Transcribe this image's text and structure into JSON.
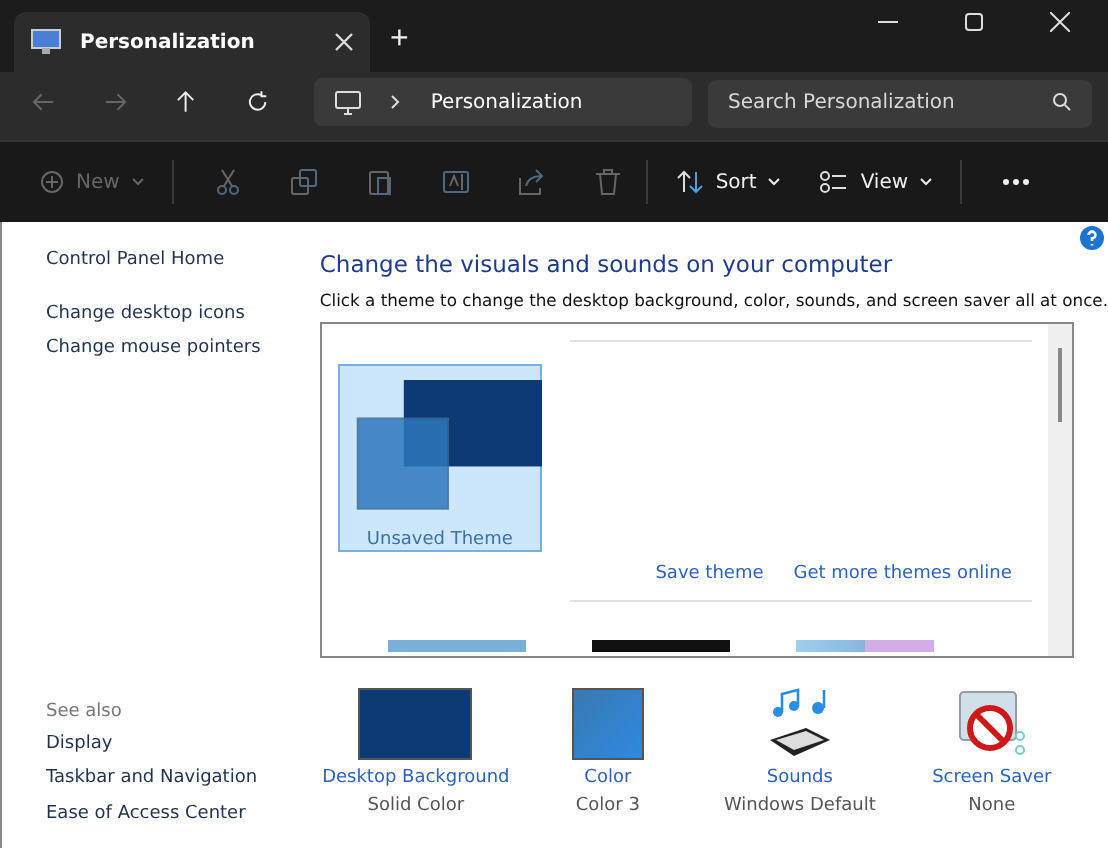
{
  "window": {
    "tab_title": "Personalization",
    "new_tab": "+"
  },
  "navigation": {
    "address": "Personalization",
    "search": {
      "placeholder": "Search Personalization"
    }
  },
  "toolbar": {
    "new": {
      "label": "New",
      "disabled": true
    },
    "sort": {
      "label": "Sort",
      "disabled": false
    },
    "view": {
      "label": "View",
      "disabled": false
    }
  },
  "sidebar": {
    "links": [
      "Control Panel Home",
      "Change desktop icons",
      "Change mouse pointers"
    ],
    "see_also_heading": "See also",
    "see_also": [
      "Display",
      "Taskbar and Navigation",
      "Ease of Access Center"
    ]
  },
  "main": {
    "title": "Change the visuals and sounds on your computer",
    "description": "Click a theme to change the desktop background, color, sounds, and screen saver all at once.",
    "themes": [
      {
        "name": "Unsaved Theme",
        "selected": true
      }
    ],
    "theme_links": [
      "Save theme",
      "Get more themes online"
    ],
    "settings": [
      {
        "kind": "background",
        "label": "Desktop Background",
        "value": "Solid Color"
      },
      {
        "kind": "color",
        "label": "Color",
        "value": "Color 3"
      },
      {
        "kind": "sounds",
        "label": "Sounds",
        "value": "Windows Default"
      },
      {
        "kind": "screensaver",
        "label": "Screen Saver",
        "value": "None"
      }
    ]
  }
}
